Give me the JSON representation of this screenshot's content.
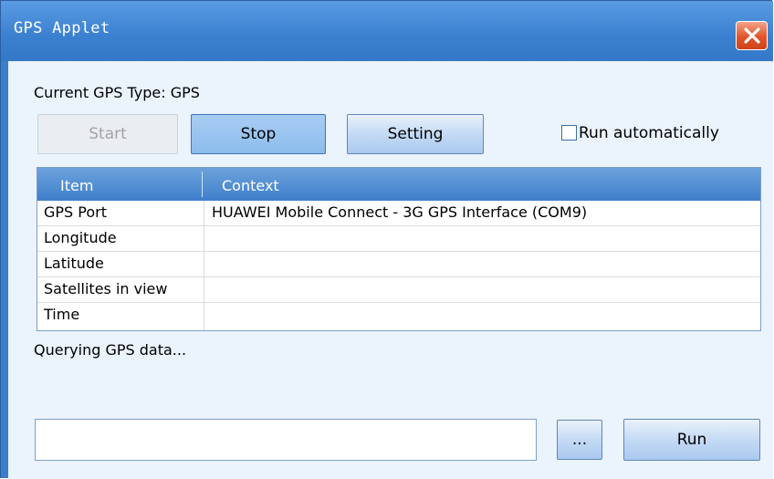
{
  "window": {
    "title": "GPS Applet"
  },
  "current_gps_type": "Current GPS Type: GPS",
  "buttons": {
    "start": "Start",
    "stop": "Stop",
    "setting": "Setting",
    "browse": "...",
    "run": "Run"
  },
  "run_automatically": {
    "label": "Run automatically",
    "checked": false
  },
  "table": {
    "headers": [
      "Item",
      "Context"
    ],
    "rows": [
      {
        "item": "GPS Port",
        "context": "HUAWEI Mobile Connect - 3G GPS Interface (COM9)"
      },
      {
        "item": "Longitude",
        "context": ""
      },
      {
        "item": "Latitude",
        "context": ""
      },
      {
        "item": "Satellites in view",
        "context": ""
      },
      {
        "item": "Time",
        "context": ""
      }
    ]
  },
  "status": "Querying GPS data...",
  "command_input": {
    "value": ""
  }
}
